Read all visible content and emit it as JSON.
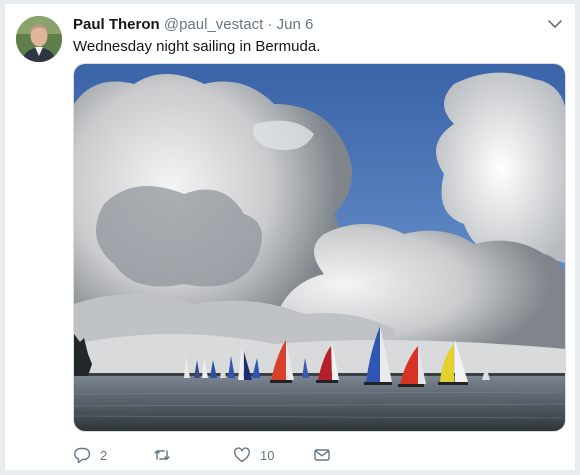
{
  "tweet": {
    "author_name": "Paul Theron",
    "author_handle": "@paul_vestact",
    "separator": "·",
    "date": "Jun 6",
    "text": "Wednesday night sailing in Bermuda."
  },
  "actions": {
    "reply_count": "2",
    "retweet_count": "",
    "like_count": "10"
  },
  "icons": [
    "avatar",
    "chevron-down-icon",
    "reply-icon",
    "retweet-icon",
    "like-icon",
    "message-icon"
  ],
  "colors": {
    "name": "#14171a",
    "muted": "#657786",
    "background": "#e6ecf0"
  }
}
